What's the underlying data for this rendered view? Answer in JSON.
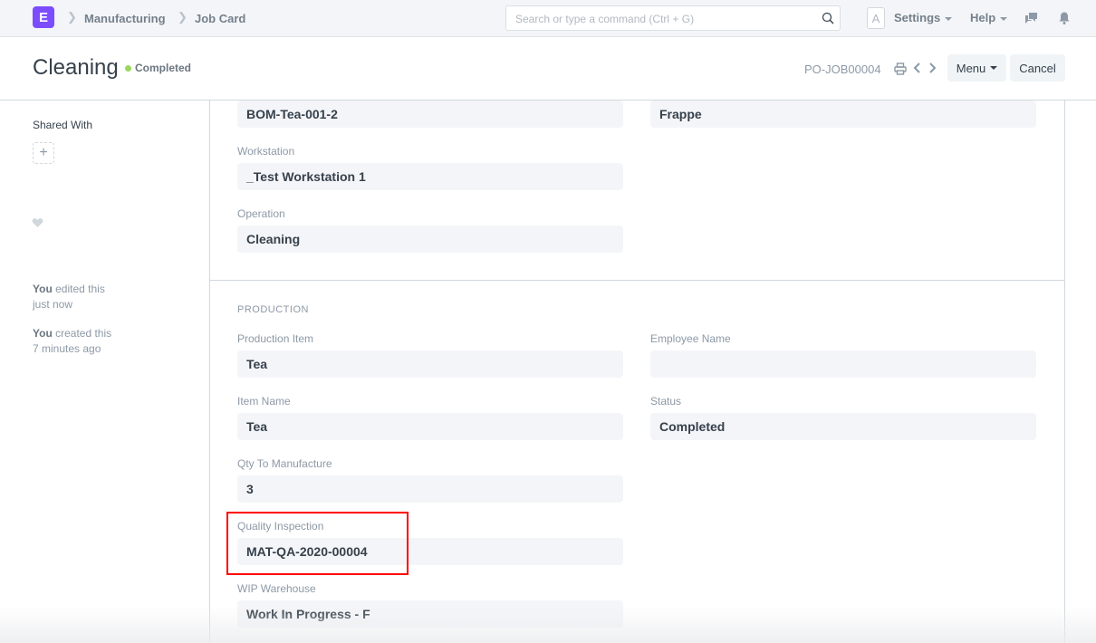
{
  "navbar": {
    "logo_letter": "E",
    "breadcrumbs": [
      "Manufacturing",
      "Job Card"
    ],
    "search_placeholder": "Search or type a command (Ctrl + G)",
    "avatar_letter": "A",
    "settings_label": "Settings",
    "help_label": "Help",
    "icons": [
      "search-icon",
      "chat-icon",
      "bell-icon"
    ]
  },
  "page_head": {
    "title": "Cleaning",
    "status": "Completed",
    "status_color": "#98d85b",
    "doc_name": "PO-JOB00004",
    "menu_label": "Menu",
    "cancel_label": "Cancel"
  },
  "sidebar": {
    "shared_with_label": "Shared With",
    "add_share": "+",
    "timeline": [
      {
        "actor": "You",
        "action": " edited this",
        "when": "just now"
      },
      {
        "actor": "You",
        "action": " created this",
        "when": "7 minutes ago"
      }
    ]
  },
  "form": {
    "top_fields": {
      "bom_no": "BOM-Tea-001-2",
      "company": "Frappe",
      "workstation_label": "Workstation",
      "workstation": "_Test Workstation 1",
      "operation_label": "Operation",
      "operation": "Cleaning"
    },
    "production_section": {
      "heading": "PRODUCTION",
      "production_item_label": "Production Item",
      "production_item": "Tea",
      "item_name_label": "Item Name",
      "item_name": "Tea",
      "qty_label": "Qty To Manufacture",
      "qty": "3",
      "quality_inspection_label": "Quality Inspection",
      "quality_inspection": "MAT-QA-2020-00004",
      "wip_warehouse_label": "WIP Warehouse",
      "wip_warehouse": "Work In Progress - F",
      "employee_name_label": "Employee Name",
      "employee_name": "",
      "status_label": "Status",
      "status": "Completed"
    }
  }
}
